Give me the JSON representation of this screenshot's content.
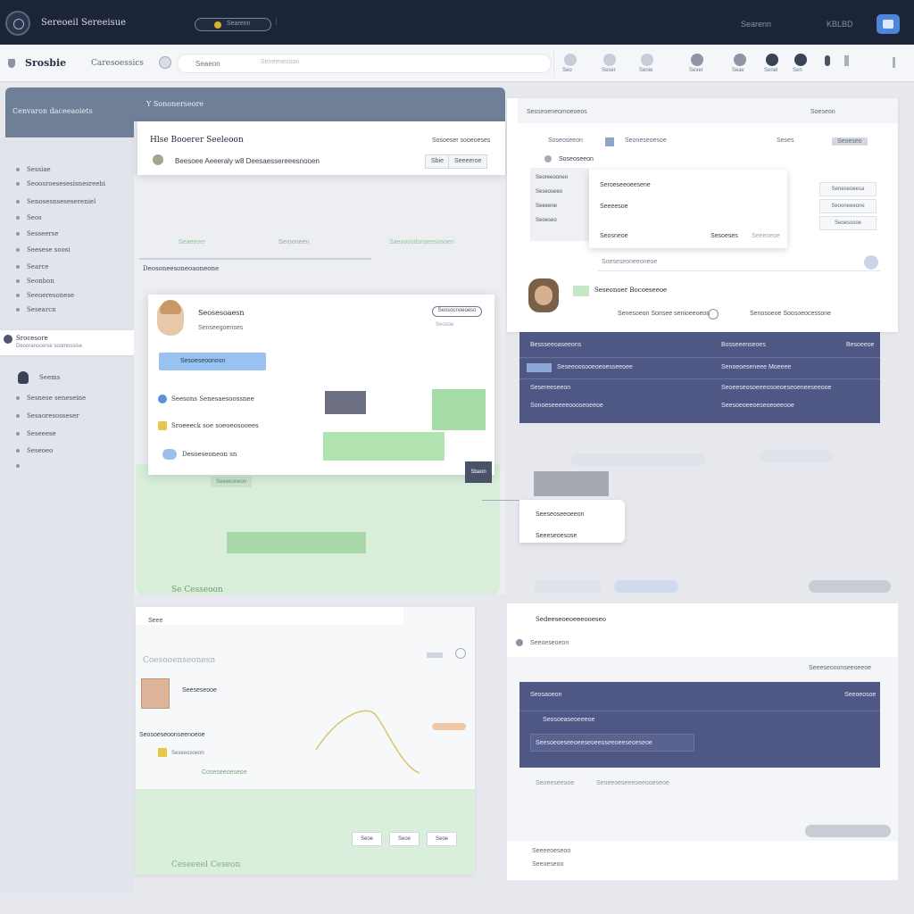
{
  "topbar": {
    "app_title": "Sereoeil Sereeisue",
    "pill_text": "Searenn",
    "right_text_1": "Searenn",
    "right_text_2": "KBLBD"
  },
  "subbar": {
    "brand": "Srosbie",
    "link": "Caresoessics",
    "search_placeholder": "Seaeon",
    "search_hint": "Seneenesoon",
    "nav_items": [
      "Seo",
      "Seser",
      "Senie",
      "Sever",
      "Seav",
      "Senel",
      "Sen"
    ]
  },
  "sidebar": {
    "header": "Cenvaron daceeaoiets",
    "items": [
      "Sessiae",
      "Seoosroesesesisnesreebi",
      "Senosesnsesesereniel",
      "Seos",
      "Sesseerse",
      "Seesese soosi",
      "Searce",
      "Seonbon",
      "Seeoeresonese",
      "Sesearcn"
    ],
    "active_title": "Srocesore",
    "active_sub": "Deooranscerse soomossise",
    "user_name": "Seems",
    "user_items": [
      "Sesnese seneseine",
      "Sesaoresosseser",
      "Seseeese",
      "Seseoeo"
    ]
  },
  "strip": {
    "title": "Y Sononerseore"
  },
  "detail": {
    "title": "Hlse Booerer Seeleoon",
    "right": "Sosoeser sooeoeses",
    "line": "Beesoee Aeeeraly   w8 Deesaessereeesnooen",
    "btn_1": "Sbie",
    "btn_2": "Seeeeroe"
  },
  "middle": {
    "tags": [
      "Seaeeoer",
      "Serooneen",
      "Saeooosdsnseesosoen"
    ],
    "section": "Deosoneesoneoaoneone"
  },
  "profile": {
    "name": "Seosesoaesn",
    "sub": "Senseegoenses",
    "chip": "Seosocnoeoeso",
    "chip2": "Seosoe",
    "blue_text": "Sesoeseoonosn",
    "row_1": "Seesons Senesaesoossnee",
    "row_2": "Sroeeeck  soe soeoeosooees",
    "row_3": "Desoeseoneon sn"
  },
  "green": {
    "chip": "Seeeeoneon",
    "label": "Se  Cesseoon",
    "float_btn": "Sbaon"
  },
  "right_top": {
    "head_left": "Sesseoeneomoeoeos",
    "head_right": "Soeseon",
    "tabs": [
      "Soseoseeon",
      "Seoneseoesoe",
      "Seses",
      "Seoeseo"
    ],
    "list": [
      "Seoreeooneo",
      "Seseoseeo",
      "Seeeene",
      "Seoeseo"
    ],
    "dropdown": [
      "Seroeseeoeesene",
      "Seeeesoe",
      "Seosneoe",
      "Sesoeses",
      "Seeeoeoe"
    ],
    "side_btns": [
      "Seneseoeesa",
      "Seooneeeone",
      "Seoesosoe"
    ],
    "input": "Soeseseoneeoneoe",
    "name": "Seseonoer Bocoeseeoe",
    "meta_1": "Senesoeon Sonsee senioeeoeon",
    "meta_2": "Senosoeoe Soosoeocessone"
  },
  "dark_table": {
    "headers": [
      "Bessseeoaseeons",
      "Bosseeenseoes",
      "Besoeeoe"
    ],
    "rows": [
      [
        "Seseeoosooeoeoesseeoee",
        "Senoeoeseneee Moeeee"
      ],
      [
        "Sesereeseeon",
        "Seoeeseosoeeeosoeoeseoeneeseeooe"
      ],
      [
        "Sonoeseeeeeoooseoeeoe",
        "Seesoeoeeoeseoeoeeooe"
      ]
    ]
  },
  "mid_right": {
    "card_1": "Seeseoseeoeeon",
    "card_2": "Seeeseoesose"
  },
  "bottom_left": {
    "tab": "Seee",
    "subhead": "Coesooenseonesn",
    "name": "Seeseseooe",
    "line_1": "Seosoeseoonseenoeoe",
    "line_2": "Seseeosoeon",
    "green_text": "Coseseeoeseoe",
    "foot": "Ceseeeel Ceseon",
    "btns": [
      "Seoe",
      "Seoe",
      "Seoe"
    ]
  },
  "bottom_right": {
    "title": "Sedeeseoeoeeeooeseo",
    "sub": "Seeoeseoeon",
    "right_meta": "Seeeseooonseeoeeoe",
    "dark_title": "Seosaoeon",
    "dark_right": "Seeoeosoe",
    "dark_row": "Seosoeaseoeeeoe",
    "inner": "Seesoeoeseeoeeseoeeoseeoeeseoeseoe",
    "row_1": "Seoeeseeooe",
    "row_2": "Seoeeoeseeeoeeooeseoe",
    "foot_1": "Seeeeoeseoo",
    "foot_2": "Seeoeseoo"
  }
}
